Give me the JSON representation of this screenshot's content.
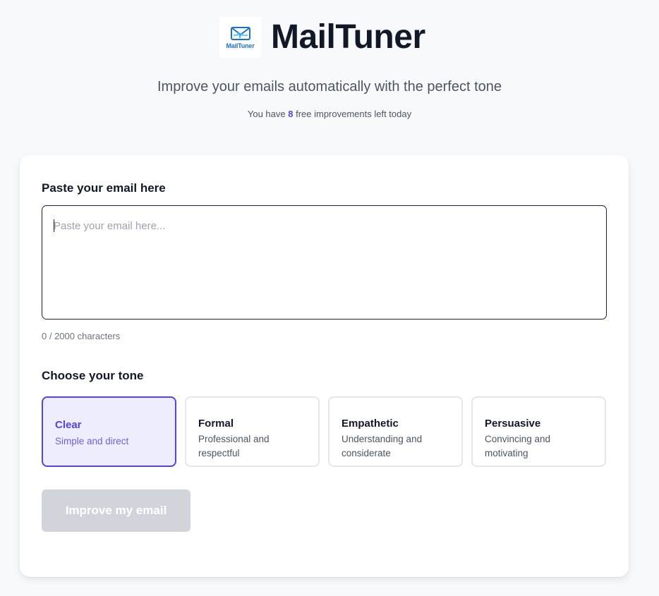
{
  "header": {
    "logo_text": "MailTuner",
    "app_name": "MailTuner",
    "subtitle": "Improve your emails automatically with the perfect tone",
    "quota_prefix": "You have",
    "quota_count": "8",
    "quota_suffix": "free improvements left today"
  },
  "email_input": {
    "label": "Paste your email here",
    "placeholder": "Paste your email here...",
    "value": "",
    "char_count": "0 / 2000 characters"
  },
  "tone": {
    "label": "Choose your tone",
    "selected": "Clear",
    "options": [
      {
        "title": "Clear",
        "description": "Simple and direct"
      },
      {
        "title": "Formal",
        "description": "Professional and respectful"
      },
      {
        "title": "Empathetic",
        "description": "Understanding and considerate"
      },
      {
        "title": "Persuasive",
        "description": "Convincing and motivating"
      }
    ]
  },
  "actions": {
    "improve_label": "Improve my email",
    "improve_disabled": true
  },
  "colors": {
    "accent": "#4f46e5",
    "selected_bg": "#eeedfd",
    "disabled_button": "#d1d5db",
    "page_bg": "#f8f9fb"
  },
  "icons": {
    "logo": "envelope-pulse-icon"
  }
}
